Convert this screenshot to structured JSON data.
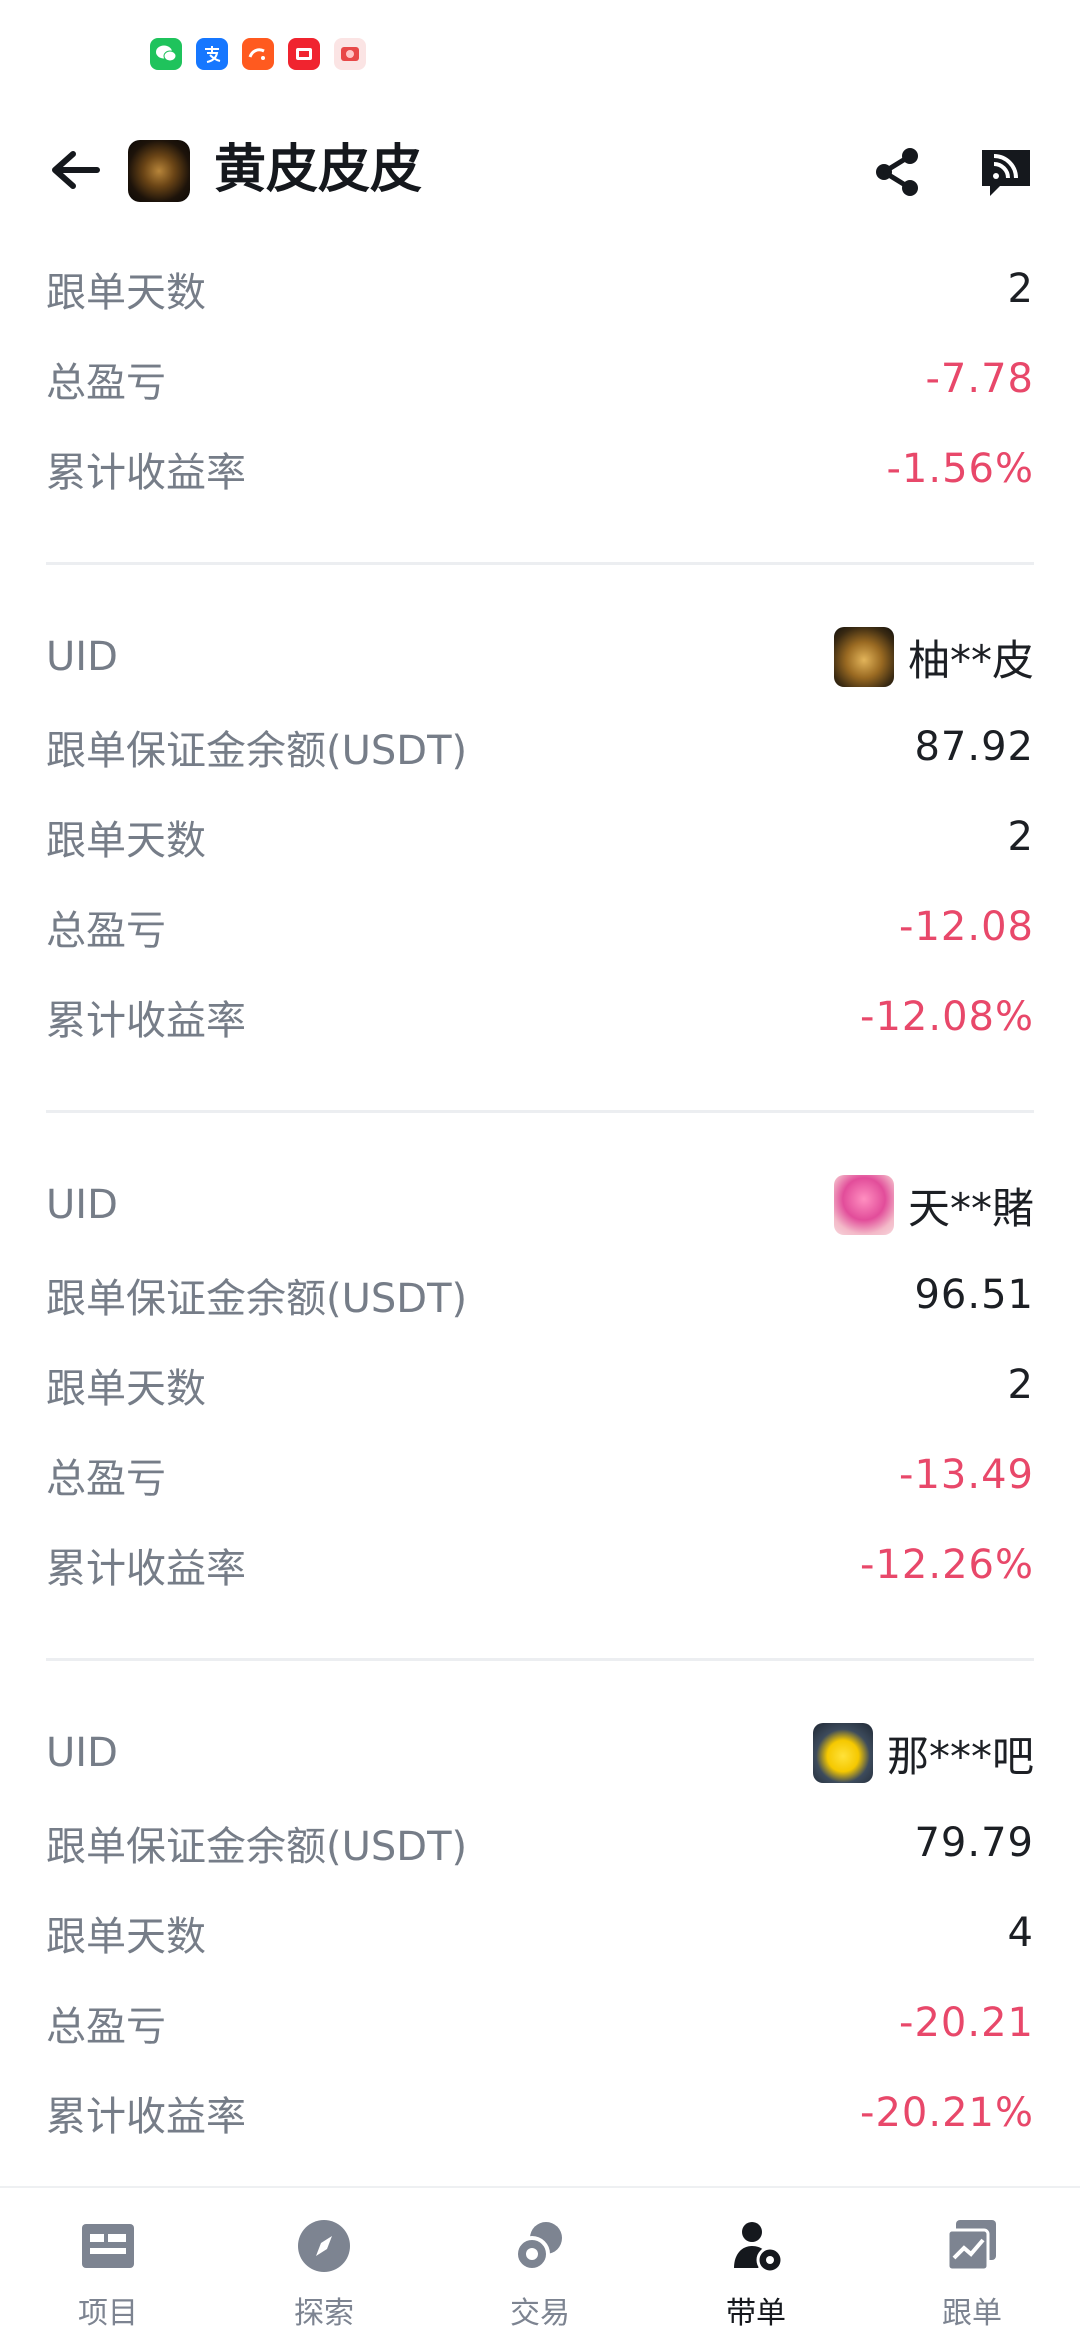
{
  "status_icons": [
    "wechat-icon",
    "alipay-icon",
    "taobao-icon",
    "red-app-icon",
    "pig-app-icon"
  ],
  "header": {
    "title": "黄皮皮皮"
  },
  "top_block": [
    {
      "label": "跟单天数",
      "value": "2",
      "negative": false
    },
    {
      "label": "总盈亏",
      "value": "-7.78",
      "negative": true
    },
    {
      "label": "累计收益率",
      "value": "-1.56%",
      "negative": true
    }
  ],
  "followers": [
    {
      "uid_label": "UID",
      "name": "柚**皮",
      "balance_label": "跟单保证金余额(USDT)",
      "balance": "87.92",
      "days_label": "跟单天数",
      "days": "2",
      "pnl_label": "总盈亏",
      "pnl": "-12.08",
      "rate_label": "累计收益率",
      "rate": "-12.08%"
    },
    {
      "uid_label": "UID",
      "name": "天**賭",
      "balance_label": "跟单保证金余额(USDT)",
      "balance": "96.51",
      "days_label": "跟单天数",
      "days": "2",
      "pnl_label": "总盈亏",
      "pnl": "-13.49",
      "rate_label": "累计收益率",
      "rate": "-12.26%"
    },
    {
      "uid_label": "UID",
      "name": "那***吧",
      "balance_label": "跟单保证金余额(USDT)",
      "balance": "79.79",
      "days_label": "跟单天数",
      "days": "4",
      "pnl_label": "总盈亏",
      "pnl": "-20.21",
      "rate_label": "累计收益率",
      "rate": "-20.21%"
    }
  ],
  "tabs": [
    {
      "label": "项目",
      "icon": "project-icon",
      "active": false
    },
    {
      "label": "探索",
      "icon": "compass-icon",
      "active": false
    },
    {
      "label": "交易",
      "icon": "trade-icon",
      "active": false
    },
    {
      "label": "带单",
      "icon": "lead-trader-icon",
      "active": true
    },
    {
      "label": "跟单",
      "icon": "copy-trade-icon",
      "active": false
    }
  ],
  "colors": {
    "negative": "#e8486a",
    "label": "#767d88",
    "text": "#1c1f24"
  }
}
